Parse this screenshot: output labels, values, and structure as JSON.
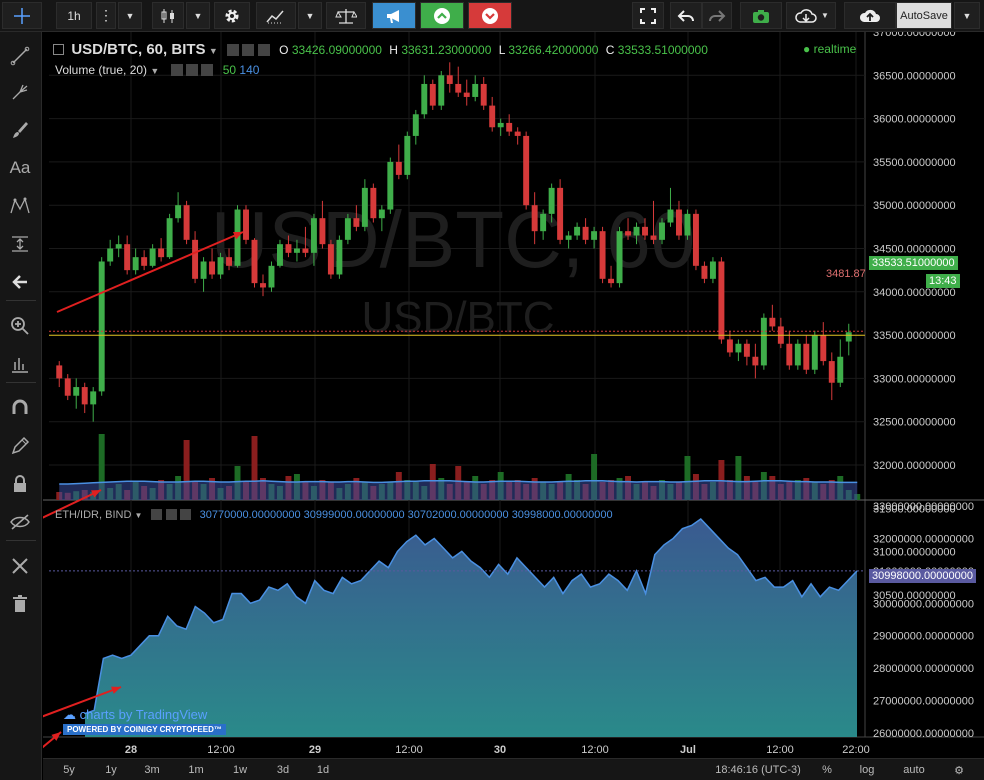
{
  "toolbar": {
    "interval": "1h",
    "autosave_label": "AutoSave",
    "colors": {
      "alert": "#3a8fd0",
      "up": "#3fae4a",
      "down": "#d63a3a"
    }
  },
  "main_legend": {
    "symbol": "USD/BTC, 60, BITS",
    "o_label": "O",
    "o_value": "33426.09000000",
    "h_label": "H",
    "h_value": "33631.23000000",
    "l_label": "L",
    "l_value": "33266.42000000",
    "c_label": "C",
    "c_value": "33533.51000000",
    "realtime": "realtime"
  },
  "volume_legend": {
    "label": "Volume (true, 20)",
    "v1": "50",
    "v2": "140"
  },
  "watermark": {
    "line1": "USD/BTC, 60",
    "line2": "USD/BTC"
  },
  "price_axis": {
    "labels": [
      "37000.00000000",
      "36500.00000000",
      "36000.00000000",
      "35500.00000000",
      "35000.00000000",
      "34500.00000000",
      "34000.00000000",
      "33500.00000000",
      "33000.00000000",
      "32500.00000000",
      "32000.00000000",
      "31500.00000000",
      "31000.00000000",
      "30500.00000000"
    ],
    "current_price": "33533.51000000",
    "countdown": "13:43",
    "line_label": "3481.87"
  },
  "lower_pane": {
    "legend_symbol": "ETH/IDR, BIND",
    "values": [
      "30770000.00000000",
      "30999000.00000000",
      "30702000.00000000",
      "30998000.00000000"
    ],
    "axis_labels": [
      "33000000.00000000",
      "32000000.00000000",
      "31000000.00000000",
      "30000000.00000000",
      "29000000.00000000",
      "28000000.00000000",
      "27000000.00000000",
      "26000000.00000000"
    ],
    "current": "30998000.00000000"
  },
  "branding": {
    "text": "charts by TradingView",
    "powered": "POWERED BY COINIGY CRYPTOFEED™"
  },
  "time_axis": {
    "labels": [
      "28",
      "12:00",
      "29",
      "12:00",
      "30",
      "12:00",
      "Jul",
      "12:00",
      "22:00"
    ]
  },
  "bottom_bar": {
    "ranges": [
      "5y",
      "1y",
      "3m",
      "1m",
      "1w",
      "3d",
      "1d"
    ],
    "clock": "18:46:16 (UTC-3)",
    "percent": "%",
    "log": "log",
    "auto": "auto"
  },
  "chart_data": {
    "type": "candlestick",
    "price_range": [
      32000,
      37000
    ],
    "series": [
      {
        "o": 33150,
        "h": 33200,
        "l": 32900,
        "c": 33000
      },
      {
        "o": 33000,
        "h": 33050,
        "l": 32750,
        "c": 32800
      },
      {
        "o": 32800,
        "h": 33000,
        "l": 32650,
        "c": 32900
      },
      {
        "o": 32900,
        "h": 32950,
        "l": 32600,
        "c": 32700
      },
      {
        "o": 32700,
        "h": 32900,
        "l": 32500,
        "c": 32850
      },
      {
        "o": 32850,
        "h": 34400,
        "l": 32800,
        "c": 34350
      },
      {
        "o": 34350,
        "h": 34600,
        "l": 34300,
        "c": 34500
      },
      {
        "o": 34500,
        "h": 34650,
        "l": 34400,
        "c": 34550
      },
      {
        "o": 34550,
        "h": 34650,
        "l": 34200,
        "c": 34250
      },
      {
        "o": 34250,
        "h": 34500,
        "l": 34200,
        "c": 34400
      },
      {
        "o": 34400,
        "h": 34480,
        "l": 34250,
        "c": 34300
      },
      {
        "o": 34300,
        "h": 34550,
        "l": 34280,
        "c": 34500
      },
      {
        "o": 34500,
        "h": 34620,
        "l": 34350,
        "c": 34400
      },
      {
        "o": 34400,
        "h": 34900,
        "l": 34380,
        "c": 34850
      },
      {
        "o": 34850,
        "h": 35150,
        "l": 34800,
        "c": 35000
      },
      {
        "o": 35000,
        "h": 35050,
        "l": 34550,
        "c": 34600
      },
      {
        "o": 34600,
        "h": 34700,
        "l": 34100,
        "c": 34150
      },
      {
        "o": 34150,
        "h": 34400,
        "l": 34000,
        "c": 34350
      },
      {
        "o": 34350,
        "h": 34500,
        "l": 34150,
        "c": 34200
      },
      {
        "o": 34200,
        "h": 34450,
        "l": 34150,
        "c": 34400
      },
      {
        "o": 34400,
        "h": 34500,
        "l": 34250,
        "c": 34300
      },
      {
        "o": 34300,
        "h": 35000,
        "l": 34280,
        "c": 34950
      },
      {
        "o": 34950,
        "h": 35000,
        "l": 34550,
        "c": 34600
      },
      {
        "o": 34600,
        "h": 34620,
        "l": 34050,
        "c": 34100
      },
      {
        "o": 34100,
        "h": 34200,
        "l": 33950,
        "c": 34050
      },
      {
        "o": 34050,
        "h": 34350,
        "l": 34000,
        "c": 34300
      },
      {
        "o": 34300,
        "h": 34600,
        "l": 34280,
        "c": 34550
      },
      {
        "o": 34550,
        "h": 34650,
        "l": 34400,
        "c": 34450
      },
      {
        "o": 34450,
        "h": 34600,
        "l": 34350,
        "c": 34500
      },
      {
        "o": 34500,
        "h": 34750,
        "l": 34400,
        "c": 34450
      },
      {
        "o": 34450,
        "h": 34900,
        "l": 34300,
        "c": 34850
      },
      {
        "o": 34850,
        "h": 35050,
        "l": 34500,
        "c": 34550
      },
      {
        "o": 34550,
        "h": 34600,
        "l": 34150,
        "c": 34200
      },
      {
        "o": 34200,
        "h": 34650,
        "l": 34150,
        "c": 34600
      },
      {
        "o": 34600,
        "h": 34900,
        "l": 34550,
        "c": 34850
      },
      {
        "o": 34850,
        "h": 35000,
        "l": 34700,
        "c": 34750
      },
      {
        "o": 34750,
        "h": 35300,
        "l": 34700,
        "c": 35200
      },
      {
        "o": 35200,
        "h": 35250,
        "l": 34800,
        "c": 34850
      },
      {
        "o": 34850,
        "h": 35000,
        "l": 34700,
        "c": 34950
      },
      {
        "o": 34950,
        "h": 35550,
        "l": 34900,
        "c": 35500
      },
      {
        "o": 35500,
        "h": 35700,
        "l": 35300,
        "c": 35350
      },
      {
        "o": 35350,
        "h": 35850,
        "l": 35300,
        "c": 35800
      },
      {
        "o": 35800,
        "h": 36100,
        "l": 35700,
        "c": 36050
      },
      {
        "o": 36050,
        "h": 36500,
        "l": 36000,
        "c": 36400
      },
      {
        "o": 36400,
        "h": 36450,
        "l": 36100,
        "c": 36150
      },
      {
        "o": 36150,
        "h": 36550,
        "l": 36100,
        "c": 36500
      },
      {
        "o": 36500,
        "h": 36650,
        "l": 36300,
        "c": 36400
      },
      {
        "o": 36400,
        "h": 36600,
        "l": 36250,
        "c": 36300
      },
      {
        "o": 36300,
        "h": 36450,
        "l": 36150,
        "c": 36250
      },
      {
        "o": 36250,
        "h": 36500,
        "l": 36200,
        "c": 36400
      },
      {
        "o": 36400,
        "h": 36480,
        "l": 36100,
        "c": 36150
      },
      {
        "o": 36150,
        "h": 36250,
        "l": 35850,
        "c": 35900
      },
      {
        "o": 35900,
        "h": 36000,
        "l": 35800,
        "c": 35950
      },
      {
        "o": 35950,
        "h": 36050,
        "l": 35800,
        "c": 35850
      },
      {
        "o": 35850,
        "h": 35900,
        "l": 35700,
        "c": 35800
      },
      {
        "o": 35800,
        "h": 35850,
        "l": 34950,
        "c": 35000
      },
      {
        "o": 35000,
        "h": 35150,
        "l": 34550,
        "c": 34700
      },
      {
        "o": 34700,
        "h": 34950,
        "l": 34600,
        "c": 34900
      },
      {
        "o": 34900,
        "h": 35250,
        "l": 34800,
        "c": 35200
      },
      {
        "o": 35200,
        "h": 35300,
        "l": 34550,
        "c": 34600
      },
      {
        "o": 34600,
        "h": 34700,
        "l": 34500,
        "c": 34650
      },
      {
        "o": 34650,
        "h": 34800,
        "l": 34600,
        "c": 34750
      },
      {
        "o": 34750,
        "h": 34850,
        "l": 34550,
        "c": 34600
      },
      {
        "o": 34600,
        "h": 34750,
        "l": 34500,
        "c": 34700
      },
      {
        "o": 34700,
        "h": 34750,
        "l": 34100,
        "c": 34150
      },
      {
        "o": 34150,
        "h": 34300,
        "l": 34050,
        "c": 34100
      },
      {
        "o": 34100,
        "h": 34750,
        "l": 34050,
        "c": 34700
      },
      {
        "o": 34700,
        "h": 34850,
        "l": 34600,
        "c": 34650
      },
      {
        "o": 34650,
        "h": 34800,
        "l": 34550,
        "c": 34750
      },
      {
        "o": 34750,
        "h": 34850,
        "l": 34600,
        "c": 34650
      },
      {
        "o": 34650,
        "h": 35050,
        "l": 34550,
        "c": 34600
      },
      {
        "o": 34600,
        "h": 34850,
        "l": 34550,
        "c": 34800
      },
      {
        "o": 34800,
        "h": 35200,
        "l": 34750,
        "c": 34950
      },
      {
        "o": 34950,
        "h": 35050,
        "l": 34600,
        "c": 34650
      },
      {
        "o": 34650,
        "h": 34950,
        "l": 34600,
        "c": 34900
      },
      {
        "o": 34900,
        "h": 34950,
        "l": 34250,
        "c": 34300
      },
      {
        "o": 34300,
        "h": 34350,
        "l": 34100,
        "c": 34150
      },
      {
        "o": 34150,
        "h": 34400,
        "l": 34100,
        "c": 34350
      },
      {
        "o": 34350,
        "h": 34400,
        "l": 33400,
        "c": 33450
      },
      {
        "o": 33450,
        "h": 33550,
        "l": 33250,
        "c": 33300
      },
      {
        "o": 33300,
        "h": 33450,
        "l": 33200,
        "c": 33400
      },
      {
        "o": 33400,
        "h": 33450,
        "l": 33150,
        "c": 33250
      },
      {
        "o": 33250,
        "h": 33400,
        "l": 33000,
        "c": 33150
      },
      {
        "o": 33150,
        "h": 33750,
        "l": 33100,
        "c": 33700
      },
      {
        "o": 33700,
        "h": 33850,
        "l": 33550,
        "c": 33600
      },
      {
        "o": 33600,
        "h": 33700,
        "l": 33350,
        "c": 33400
      },
      {
        "o": 33400,
        "h": 33550,
        "l": 33100,
        "c": 33150
      },
      {
        "o": 33150,
        "h": 33450,
        "l": 33100,
        "c": 33400
      },
      {
        "o": 33400,
        "h": 33500,
        "l": 33050,
        "c": 33100
      },
      {
        "o": 33100,
        "h": 33550,
        "l": 33050,
        "c": 33500
      },
      {
        "o": 33500,
        "h": 33650,
        "l": 33150,
        "c": 33200
      },
      {
        "o": 33200,
        "h": 33300,
        "l": 32750,
        "c": 32950
      },
      {
        "o": 32950,
        "h": 33450,
        "l": 32900,
        "c": 33250
      },
      {
        "o": 33426,
        "h": 33631,
        "l": 33266,
        "c": 33533
      }
    ],
    "volume": [
      20,
      18,
      22,
      25,
      20,
      165,
      30,
      40,
      25,
      45,
      35,
      30,
      50,
      40,
      60,
      150,
      45,
      40,
      55,
      30,
      35,
      85,
      45,
      160,
      55,
      40,
      35,
      60,
      65,
      45,
      35,
      50,
      45,
      30,
      40,
      55,
      45,
      35,
      40,
      45,
      70,
      50,
      45,
      35,
      90,
      55,
      40,
      85,
      45,
      60,
      40,
      50,
      70,
      45,
      50,
      40,
      55,
      45,
      40,
      45,
      65,
      50,
      40,
      115,
      45,
      50,
      55,
      60,
      40,
      45,
      35,
      50,
      40,
      45,
      110,
      65,
      40,
      45,
      100,
      50,
      110,
      60,
      45,
      70,
      60,
      40,
      45,
      50,
      55,
      45,
      40,
      50,
      60,
      25,
      15
    ],
    "volume_ma": [
      40,
      40,
      41,
      42,
      43,
      44,
      45,
      46,
      47,
      47,
      47,
      46,
      45,
      45,
      45,
      46,
      47,
      47,
      46,
      45,
      45,
      46,
      47,
      47,
      48,
      47,
      46,
      45,
      45,
      46,
      46,
      46,
      45,
      45,
      46,
      46,
      45,
      44,
      44,
      45,
      46,
      47,
      47,
      48,
      48,
      48,
      48,
      47,
      46,
      45,
      45,
      46,
      47,
      47,
      47,
      46,
      45,
      45,
      45,
      46,
      47,
      47,
      48,
      48,
      48,
      47,
      46,
      46,
      45,
      46,
      46,
      46,
      45,
      45,
      46,
      47,
      48,
      48,
      48,
      47,
      46,
      46,
      47,
      48,
      48,
      48,
      47,
      46,
      46,
      45,
      45,
      45,
      44,
      44,
      44
    ],
    "volume_range": [
      0,
      300
    ],
    "eth_range": [
      26000000,
      33000000
    ],
    "eth_idr": [
      26600000,
      26700000,
      28300000,
      28400000,
      28300000,
      28400000,
      28700000,
      29000000,
      29000000,
      29600000,
      29300000,
      29200000,
      29900000,
      29700000,
      29400000,
      29500000,
      30300000,
      30300000,
      30000000,
      30100000,
      30500000,
      30400000,
      30600000,
      30200000,
      30000000,
      30700000,
      30400000,
      30300000,
      30800000,
      30600000,
      30700000,
      31000000,
      31300000,
      31100000,
      31600000,
      31900000,
      32100000,
      31800000,
      32000000,
      31700000,
      31400000,
      31600000,
      31300000,
      31100000,
      30800000,
      31200000,
      30900000,
      31400000,
      31100000,
      30800000,
      30500000,
      30800000,
      30300000,
      30700000,
      30900000,
      30500000,
      30600000,
      30900000,
      30700000,
      30400000,
      31000000,
      30300000,
      31500000,
      31800000,
      32000000,
      32300000,
      32400000,
      32600000,
      32300000,
      32000000,
      31700000,
      31500000,
      31100000,
      30700000,
      30800000,
      30500000,
      30500000,
      30700000,
      30200000,
      30600000,
      30200000,
      30500000,
      30400000,
      30700000,
      30998000
    ]
  }
}
